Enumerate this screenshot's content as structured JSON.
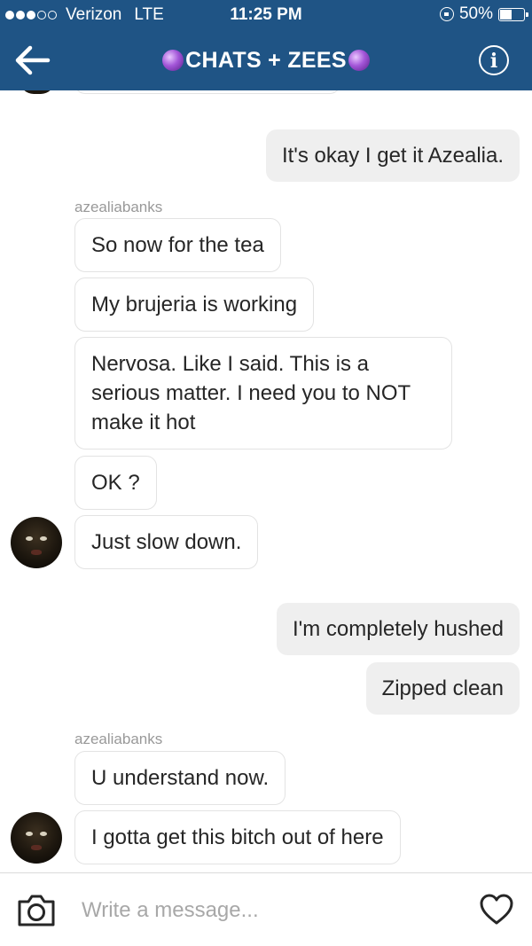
{
  "status_bar": {
    "carrier": "Verizon",
    "network": "LTE",
    "time": "11:25 PM",
    "battery": "50%",
    "battery_level": 0.5,
    "signal_bars_filled": 3,
    "signal_bars_total": 5
  },
  "nav": {
    "title": "CHATS + ZEES",
    "back_icon": "arrow-left-icon",
    "info_icon": "info-icon",
    "title_emoji": "crystal-ball-icon"
  },
  "messages": [
    {
      "direction": "out",
      "text": "It's okay I get it Azealia."
    },
    {
      "direction": "in",
      "sender": "azealiabanks",
      "text": "So now for the tea"
    },
    {
      "direction": "in",
      "text": "My brujeria is working"
    },
    {
      "direction": "in",
      "text": "Nervosa. Like I said. This is a serious matter. I need you to NOT make it hot"
    },
    {
      "direction": "in",
      "text": "OK ?"
    },
    {
      "direction": "in",
      "text": "Just slow down.",
      "avatar": true
    },
    {
      "direction": "out",
      "text": "I'm completely hushed"
    },
    {
      "direction": "out",
      "text": "Zipped clean"
    },
    {
      "direction": "in",
      "sender": "azealiabanks",
      "text": "U understand now."
    },
    {
      "direction": "in",
      "text": "I gotta get this bitch out of here",
      "avatar": true
    }
  ],
  "composer": {
    "placeholder": "Write a message...",
    "camera_icon": "camera-icon",
    "heart_icon": "heart-icon"
  },
  "colors": {
    "header": "#1f5485",
    "outgoing_bubble": "#efefef",
    "incoming_border": "#e3e3e3",
    "sender_label": "#999999"
  }
}
